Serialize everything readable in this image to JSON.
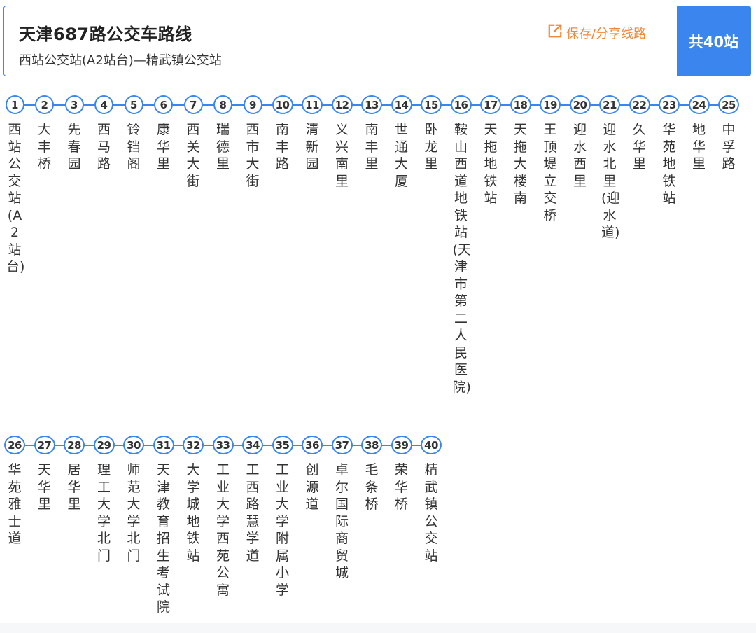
{
  "header": {
    "title": "天津687路公交车路线",
    "subtitle": "西站公交站(A2站台)—精武镇公交站",
    "share_label": "保存/分享线路",
    "count_label": "共40站"
  },
  "stops": [
    {
      "num": "1",
      "name": "西站公交站(A2站台)"
    },
    {
      "num": "2",
      "name": "大丰桥"
    },
    {
      "num": "3",
      "name": "先春园"
    },
    {
      "num": "4",
      "name": "西马路"
    },
    {
      "num": "5",
      "name": "铃铛阁"
    },
    {
      "num": "6",
      "name": "康华里"
    },
    {
      "num": "7",
      "name": "西关大街"
    },
    {
      "num": "8",
      "name": "瑞德里"
    },
    {
      "num": "9",
      "name": "西市大街"
    },
    {
      "num": "10",
      "name": "南丰路"
    },
    {
      "num": "11",
      "name": "清新园"
    },
    {
      "num": "12",
      "name": "义兴南里"
    },
    {
      "num": "13",
      "name": "南丰里"
    },
    {
      "num": "14",
      "name": "世通大厦"
    },
    {
      "num": "15",
      "name": "卧龙里"
    },
    {
      "num": "16",
      "name": "鞍山西道地铁站(天津市第二人民医院)"
    },
    {
      "num": "17",
      "name": "天拖地铁站"
    },
    {
      "num": "18",
      "name": "天拖大楼南"
    },
    {
      "num": "19",
      "name": "王顶堤立交桥"
    },
    {
      "num": "20",
      "name": "迎水西里"
    },
    {
      "num": "21",
      "name": "迎水北里(迎水道)"
    },
    {
      "num": "22",
      "name": "久华里"
    },
    {
      "num": "23",
      "name": "华苑地铁站"
    },
    {
      "num": "24",
      "name": "地华里"
    },
    {
      "num": "25",
      "name": "中孚路"
    },
    {
      "num": "26",
      "name": "华苑雅士道"
    },
    {
      "num": "27",
      "name": "天华里"
    },
    {
      "num": "28",
      "name": "居华里"
    },
    {
      "num": "29",
      "name": "理工大学北门"
    },
    {
      "num": "30",
      "name": "师范大学北门"
    },
    {
      "num": "31",
      "name": "天津教育招生考试院"
    },
    {
      "num": "32",
      "name": "大学城地铁站"
    },
    {
      "num": "33",
      "name": "工业大学西苑公寓"
    },
    {
      "num": "34",
      "name": "工西路慧学道"
    },
    {
      "num": "35",
      "name": "工业大学附属小学"
    },
    {
      "num": "36",
      "name": "创源道"
    },
    {
      "num": "37",
      "name": "卓尔国际商贸城"
    },
    {
      "num": "38",
      "name": "毛条桥"
    },
    {
      "num": "39",
      "name": "荣华桥"
    },
    {
      "num": "40",
      "name": "精武镇公交站"
    }
  ],
  "colors": {
    "accent": "#3a85ee",
    "share": "#f0883a",
    "text": "#333333"
  },
  "icons": {
    "share": "external-link-icon"
  }
}
